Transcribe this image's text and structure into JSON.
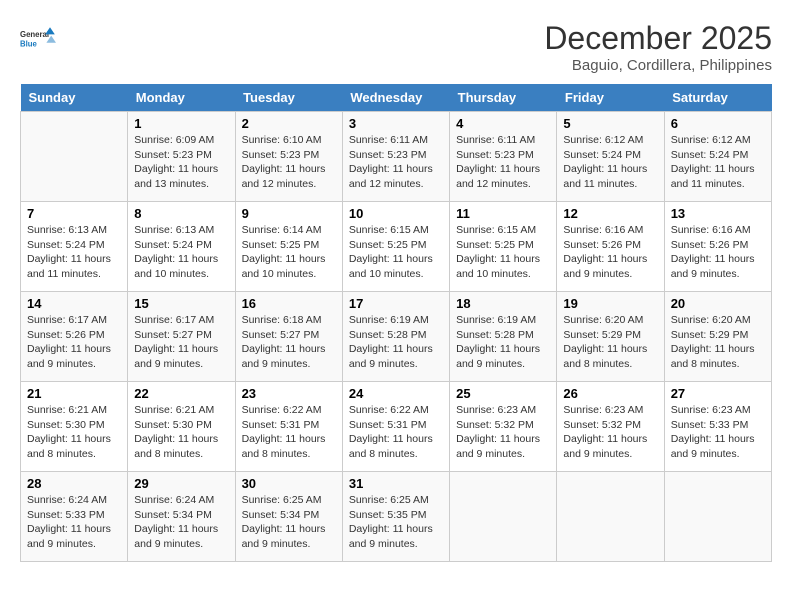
{
  "logo": {
    "line1": "General",
    "line2": "Blue"
  },
  "title": "December 2025",
  "location": "Baguio, Cordillera, Philippines",
  "headers": [
    "Sunday",
    "Monday",
    "Tuesday",
    "Wednesday",
    "Thursday",
    "Friday",
    "Saturday"
  ],
  "weeks": [
    [
      {
        "day": "",
        "info": ""
      },
      {
        "day": "1",
        "info": "Sunrise: 6:09 AM\nSunset: 5:23 PM\nDaylight: 11 hours\nand 13 minutes."
      },
      {
        "day": "2",
        "info": "Sunrise: 6:10 AM\nSunset: 5:23 PM\nDaylight: 11 hours\nand 12 minutes."
      },
      {
        "day": "3",
        "info": "Sunrise: 6:11 AM\nSunset: 5:23 PM\nDaylight: 11 hours\nand 12 minutes."
      },
      {
        "day": "4",
        "info": "Sunrise: 6:11 AM\nSunset: 5:23 PM\nDaylight: 11 hours\nand 12 minutes."
      },
      {
        "day": "5",
        "info": "Sunrise: 6:12 AM\nSunset: 5:24 PM\nDaylight: 11 hours\nand 11 minutes."
      },
      {
        "day": "6",
        "info": "Sunrise: 6:12 AM\nSunset: 5:24 PM\nDaylight: 11 hours\nand 11 minutes."
      }
    ],
    [
      {
        "day": "7",
        "info": "Sunrise: 6:13 AM\nSunset: 5:24 PM\nDaylight: 11 hours\nand 11 minutes."
      },
      {
        "day": "8",
        "info": "Sunrise: 6:13 AM\nSunset: 5:24 PM\nDaylight: 11 hours\nand 10 minutes."
      },
      {
        "day": "9",
        "info": "Sunrise: 6:14 AM\nSunset: 5:25 PM\nDaylight: 11 hours\nand 10 minutes."
      },
      {
        "day": "10",
        "info": "Sunrise: 6:15 AM\nSunset: 5:25 PM\nDaylight: 11 hours\nand 10 minutes."
      },
      {
        "day": "11",
        "info": "Sunrise: 6:15 AM\nSunset: 5:25 PM\nDaylight: 11 hours\nand 10 minutes."
      },
      {
        "day": "12",
        "info": "Sunrise: 6:16 AM\nSunset: 5:26 PM\nDaylight: 11 hours\nand 9 minutes."
      },
      {
        "day": "13",
        "info": "Sunrise: 6:16 AM\nSunset: 5:26 PM\nDaylight: 11 hours\nand 9 minutes."
      }
    ],
    [
      {
        "day": "14",
        "info": "Sunrise: 6:17 AM\nSunset: 5:26 PM\nDaylight: 11 hours\nand 9 minutes."
      },
      {
        "day": "15",
        "info": "Sunrise: 6:17 AM\nSunset: 5:27 PM\nDaylight: 11 hours\nand 9 minutes."
      },
      {
        "day": "16",
        "info": "Sunrise: 6:18 AM\nSunset: 5:27 PM\nDaylight: 11 hours\nand 9 minutes."
      },
      {
        "day": "17",
        "info": "Sunrise: 6:19 AM\nSunset: 5:28 PM\nDaylight: 11 hours\nand 9 minutes."
      },
      {
        "day": "18",
        "info": "Sunrise: 6:19 AM\nSunset: 5:28 PM\nDaylight: 11 hours\nand 9 minutes."
      },
      {
        "day": "19",
        "info": "Sunrise: 6:20 AM\nSunset: 5:29 PM\nDaylight: 11 hours\nand 8 minutes."
      },
      {
        "day": "20",
        "info": "Sunrise: 6:20 AM\nSunset: 5:29 PM\nDaylight: 11 hours\nand 8 minutes."
      }
    ],
    [
      {
        "day": "21",
        "info": "Sunrise: 6:21 AM\nSunset: 5:30 PM\nDaylight: 11 hours\nand 8 minutes."
      },
      {
        "day": "22",
        "info": "Sunrise: 6:21 AM\nSunset: 5:30 PM\nDaylight: 11 hours\nand 8 minutes."
      },
      {
        "day": "23",
        "info": "Sunrise: 6:22 AM\nSunset: 5:31 PM\nDaylight: 11 hours\nand 8 minutes."
      },
      {
        "day": "24",
        "info": "Sunrise: 6:22 AM\nSunset: 5:31 PM\nDaylight: 11 hours\nand 8 minutes."
      },
      {
        "day": "25",
        "info": "Sunrise: 6:23 AM\nSunset: 5:32 PM\nDaylight: 11 hours\nand 9 minutes."
      },
      {
        "day": "26",
        "info": "Sunrise: 6:23 AM\nSunset: 5:32 PM\nDaylight: 11 hours\nand 9 minutes."
      },
      {
        "day": "27",
        "info": "Sunrise: 6:23 AM\nSunset: 5:33 PM\nDaylight: 11 hours\nand 9 minutes."
      }
    ],
    [
      {
        "day": "28",
        "info": "Sunrise: 6:24 AM\nSunset: 5:33 PM\nDaylight: 11 hours\nand 9 minutes."
      },
      {
        "day": "29",
        "info": "Sunrise: 6:24 AM\nSunset: 5:34 PM\nDaylight: 11 hours\nand 9 minutes."
      },
      {
        "day": "30",
        "info": "Sunrise: 6:25 AM\nSunset: 5:34 PM\nDaylight: 11 hours\nand 9 minutes."
      },
      {
        "day": "31",
        "info": "Sunrise: 6:25 AM\nSunset: 5:35 PM\nDaylight: 11 hours\nand 9 minutes."
      },
      {
        "day": "",
        "info": ""
      },
      {
        "day": "",
        "info": ""
      },
      {
        "day": "",
        "info": ""
      }
    ]
  ]
}
